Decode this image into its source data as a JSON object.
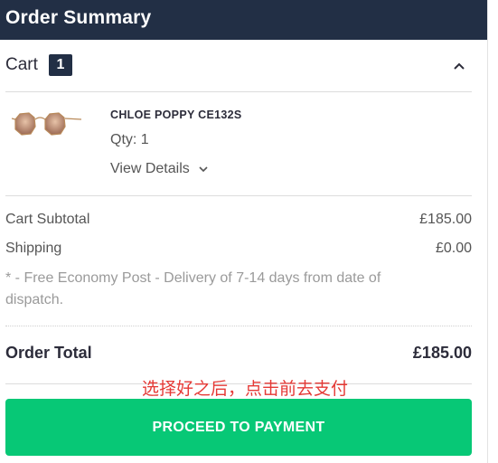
{
  "header": {
    "title": "Order Summary"
  },
  "cart": {
    "label": "Cart",
    "count": "1",
    "collapse_icon": "chevron-up-icon"
  },
  "item": {
    "name": "CHLOE POPPY CE132S",
    "qty": "Qty: 1",
    "view_details": "View Details",
    "image_icon": "sunglasses-image"
  },
  "totals": {
    "subtotal_label": "Cart Subtotal",
    "subtotal_value": "£185.00",
    "shipping_label": "Shipping",
    "shipping_value": "£0.00",
    "shipping_note": "* - Free Economy Post - Delivery of 7-14 days from date of dispatch.",
    "order_total_label": "Order Total",
    "order_total_value": "£185.00"
  },
  "annotation": "选择好之后，点击前去支付",
  "payment": {
    "button_label": "PROCEED TO PAYMENT"
  },
  "colors": {
    "header_bg": "#222f45",
    "button_bg": "#07c876",
    "annotation": "#e53935"
  }
}
